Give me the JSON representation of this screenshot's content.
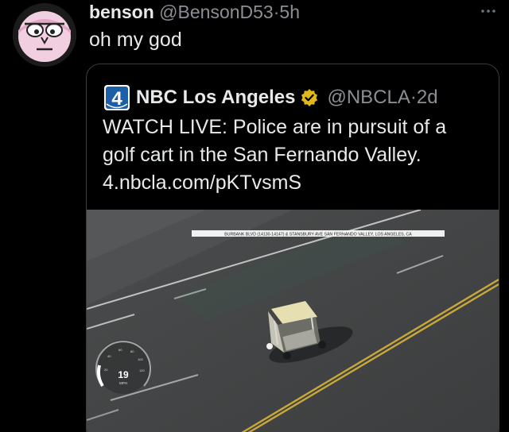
{
  "tweet": {
    "display_name": "benson",
    "handle": "@BensonD53",
    "separator": "·",
    "time": "5h",
    "text": "oh my god",
    "more_icon": "more-horizontal-icon"
  },
  "quote": {
    "display_name": "NBC Los Angeles",
    "handle": "@NBCLA",
    "separator": "·",
    "time": "2d",
    "logo_icon": "nbc-4-logo-icon",
    "badge_icon": "verified-badge-icon",
    "text_lines": [
      "WATCH LIVE: Police are in pursuit of a",
      "golf cart in the San Fernando Valley.",
      "4.nbcla.com/pKTvsmS"
    ],
    "video": {
      "location_caption": "BURBANK BLVD (14130-14147) & STANSBURY AVE  SAN FERNANDO VALLEY, LOS ANGELES, CA",
      "speed_value": "19",
      "speed_unit": "MPH"
    }
  },
  "colors": {
    "background": "#000000",
    "text_primary": "#e7e9ea",
    "text_secondary": "#8b8f94",
    "quote_border": "#3a3d40",
    "verified_gold": "#e2b719",
    "nbc_blue": "#1d5fa7"
  }
}
